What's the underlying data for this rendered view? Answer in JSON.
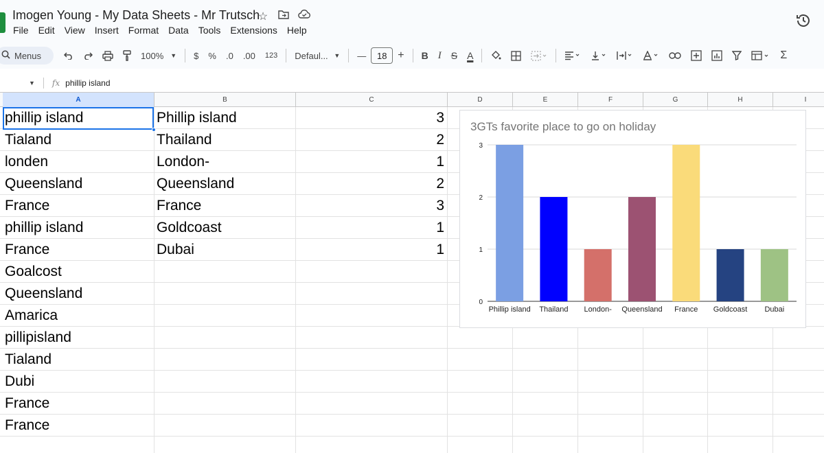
{
  "header": {
    "doc_title": "Imogen Young - My Data Sheets - Mr Trutsch",
    "menu": [
      "File",
      "Edit",
      "View",
      "Insert",
      "Format",
      "Data",
      "Tools",
      "Extensions",
      "Help"
    ]
  },
  "toolbar": {
    "menus_label": "Menus",
    "zoom": "100%",
    "currency": "$",
    "percent": "%",
    "decrease_decimal": ".0",
    "increase_decimal": ".00",
    "number_format": "123",
    "font_name": "Defaul...",
    "minus": "—",
    "font_size": "18",
    "plus": "+",
    "bold": "B",
    "italic": "I",
    "strike": "S",
    "text_color": "A"
  },
  "formula_bar": {
    "fx": "fx",
    "value": "phillip island"
  },
  "columns": [
    "A",
    "B",
    "C",
    "D",
    "E",
    "F",
    "G",
    "H",
    "I"
  ],
  "rows": [
    {
      "a": "phillip island",
      "b": "Phillip island",
      "c": "3"
    },
    {
      "a": "Tialand",
      "b": "Thailand",
      "c": "2"
    },
    {
      "a": "londen",
      "b": "London-",
      "c": "1"
    },
    {
      "a": "Queensland",
      "b": "Queensland",
      "c": "2"
    },
    {
      "a": "France",
      "b": "France",
      "c": "3"
    },
    {
      "a": "phillip island",
      "b": "Goldcoast",
      "c": "1"
    },
    {
      "a": "France",
      "b": "Dubai",
      "c": "1"
    },
    {
      "a": "Goalcost",
      "b": "",
      "c": ""
    },
    {
      "a": "Queensland",
      "b": "",
      "c": ""
    },
    {
      "a": "Amarica",
      "b": "",
      "c": ""
    },
    {
      "a": "pillipisland",
      "b": "",
      "c": ""
    },
    {
      "a": "Tialand",
      "b": "",
      "c": ""
    },
    {
      "a": "Dubi",
      "b": "",
      "c": ""
    },
    {
      "a": "France",
      "b": "",
      "c": ""
    },
    {
      "a": "France",
      "b": "",
      "c": ""
    },
    {
      "a": "",
      "b": "",
      "c": ""
    }
  ],
  "chart_data": {
    "type": "bar",
    "title": "3GTs  favorite place to go on holiday",
    "categories": [
      "Phillip island",
      "Thailand",
      "London-",
      "Queensland",
      "France",
      "Goldcoast",
      "Dubai"
    ],
    "values": [
      3,
      2,
      1,
      2,
      3,
      1,
      1
    ],
    "colors": [
      "#7b9fe3",
      "#0000ff",
      "#d4706a",
      "#9c5272",
      "#fadb7a",
      "#254381",
      "#9ec284"
    ],
    "yticks": [
      0,
      1,
      2,
      3
    ],
    "ylim": [
      0,
      3
    ],
    "grid": true
  }
}
